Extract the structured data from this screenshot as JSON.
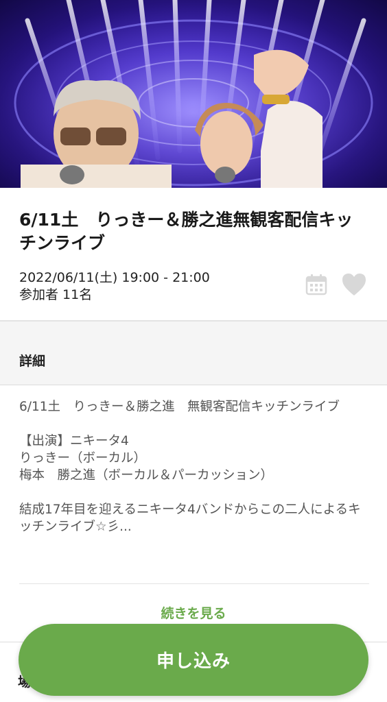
{
  "event": {
    "title": "6/11土　りっきー＆勝之進無観客配信キッチンライブ",
    "datetime": "2022/06/11(土) 19:00 - 21:00",
    "participants": "参加者 11名"
  },
  "icons": {
    "calendar": "calendar-icon",
    "favorite": "heart-icon"
  },
  "details": {
    "section_title": "詳細",
    "paragraphs": [
      "6/11土　りっきー＆勝之進　無観客配信キッチンライブ",
      "【出演】ニキータ4\nりっきー（ボーカル）\n梅本　勝之進（ボーカル＆パーカッション）",
      "結成17年目を迎えるニキータ4バンドからこの二人によるキッチンライブ☆彡..."
    ],
    "more_label": "続きを見る"
  },
  "below_section_partial": "場",
  "apply_button": {
    "label": "申し込み"
  },
  "colors": {
    "accent": "#6aaa4b",
    "icon_gray": "#d8d8d8"
  }
}
